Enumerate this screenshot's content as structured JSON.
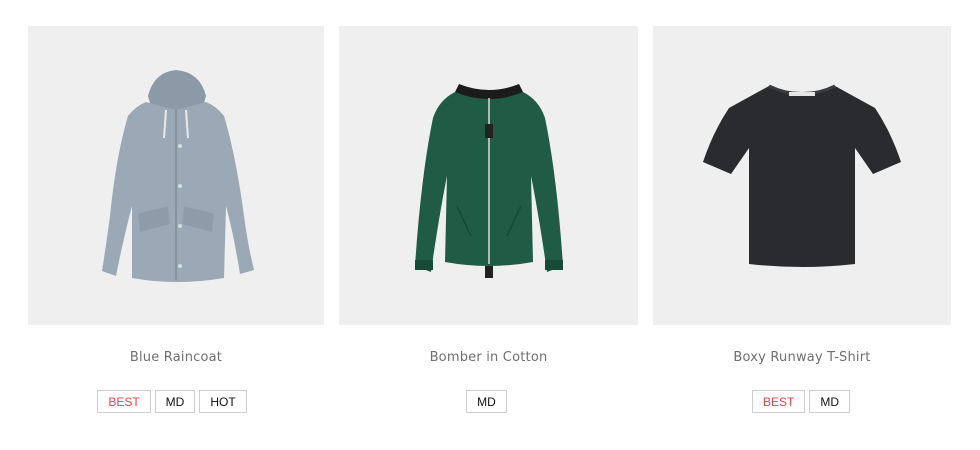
{
  "products": [
    {
      "name": "Blue Raincoat",
      "image_icon": "raincoat-icon",
      "badges": [
        "BEST",
        "MD",
        "HOT"
      ]
    },
    {
      "name": "Bomber in Cotton",
      "image_icon": "bomber-jacket-icon",
      "badges": [
        "MD"
      ]
    },
    {
      "name": "Boxy Runway T-Shirt",
      "image_icon": "tshirt-icon",
      "badges": [
        "BEST",
        "MD"
      ]
    }
  ],
  "colors": {
    "image_background": "#efeff0",
    "badge_best": "#e8453c",
    "badge_border": "#cfcfcf",
    "product_name": "#6f6f6f",
    "raincoat": "#9aa9b5",
    "bomber": "#1f5b45",
    "tshirt": "#2a2b2e"
  }
}
